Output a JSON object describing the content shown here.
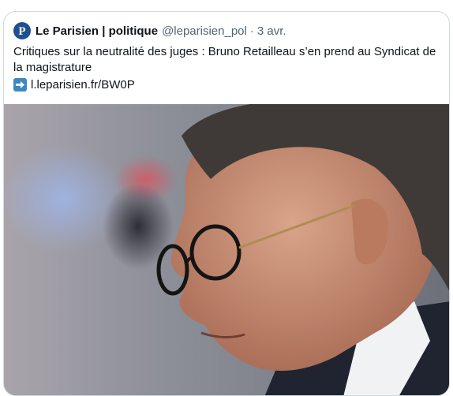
{
  "tweet": {
    "author_name": "Le Parisien | politique",
    "handle": "@leparisien_pol",
    "separator": "·",
    "date": "3 avr.",
    "text": "Critiques sur la neutralité des juges : Bruno Retailleau s’en prend au Syndicat de la magistrature",
    "link_text": "l.leparisien.fr/BW0P",
    "avatar_letter": "P"
  },
  "icons": {
    "avatar": "le-parisien-logo",
    "link_prefix": "right-arrow-emoji"
  },
  "colors": {
    "avatar_bg": "#1d4f91",
    "arrow_emoji_bg": "#3b88c3",
    "text": "#0f1419",
    "muted": "#536471"
  }
}
